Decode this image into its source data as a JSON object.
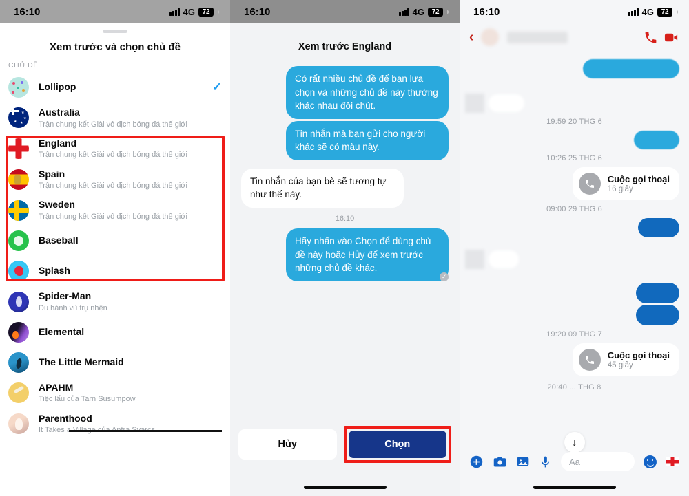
{
  "status_bar": {
    "time": "16:10",
    "network": "4G",
    "battery": "72"
  },
  "panel_theme_picker": {
    "sheet_title": "Xem trước và chọn chủ đề",
    "section_label": "CHỦ ĐỀ",
    "selected_theme": "Lollipop",
    "items": [
      {
        "name": "Lollipop",
        "subtitle": "",
        "icon": "lollipop-avatar",
        "selected": true
      },
      {
        "name": "Australia",
        "subtitle": "Trận chung kết Giải vô địch bóng đá thế giới",
        "icon": "flag-australia-icon",
        "selected": false
      },
      {
        "name": "England",
        "subtitle": "Trận chung kết Giải vô địch bóng đá thế giới",
        "icon": "flag-england-icon",
        "selected": false
      },
      {
        "name": "Spain",
        "subtitle": "Trận chung kết Giải vô địch bóng đá thế giới",
        "icon": "flag-spain-icon",
        "selected": false
      },
      {
        "name": "Sweden",
        "subtitle": "Trận chung kết Giải vô địch bóng đá thế giới",
        "icon": "flag-sweden-icon",
        "selected": false
      },
      {
        "name": "Baseball",
        "subtitle": "",
        "icon": "baseball-avatar",
        "selected": false
      },
      {
        "name": "Splash",
        "subtitle": "",
        "icon": "splash-avatar",
        "selected": false
      },
      {
        "name": "Spider-Man",
        "subtitle": "Du hành vũ trụ nhện",
        "icon": "spiderman-avatar",
        "selected": false
      },
      {
        "name": "Elemental",
        "subtitle": "",
        "icon": "elemental-avatar",
        "selected": false
      },
      {
        "name": "The Little Mermaid",
        "subtitle": "",
        "icon": "mermaid-avatar",
        "selected": false
      },
      {
        "name": "APAHM",
        "subtitle": "Tiệc lẩu của Tarn Susumpow",
        "icon": "apahm-avatar",
        "selected": false
      },
      {
        "name": "Parenthood",
        "subtitle": "It Takes a Village của Antra Svarcs",
        "icon": "parenthood-avatar",
        "selected": false
      }
    ]
  },
  "panel_preview": {
    "title": "Xem trước England",
    "messages": [
      {
        "side": "out",
        "text": "Có rất nhiều chủ đề để bạn lựa chọn và những chủ đề này thường khác nhau đôi chút."
      },
      {
        "side": "out",
        "text": "Tin nhắn mà bạn gửi cho người khác sẽ có màu này."
      },
      {
        "side": "in",
        "text": "Tin nhắn của bạn bè sẽ tương tự như thế này."
      }
    ],
    "timestamp": "16:10",
    "last_message": {
      "side": "out",
      "text": "Hãy nhấn vào Chọn để dùng chủ đề này hoặc Hủy để xem trước những chủ đề khác."
    },
    "cancel_label": "Hủy",
    "choose_label": "Chọn"
  },
  "panel_conversation": {
    "timestamps": [
      "19:59 20 THG 6",
      "10:26 25 THG 6",
      "09:00 29 THG 6",
      "19:20 09 THG 7",
      "20:40 ... THG 8"
    ],
    "calls": [
      {
        "title": "Cuộc gọi thoại",
        "duration": "16 giây"
      },
      {
        "title": "Cuộc gọi thoại",
        "duration": "45 giây"
      }
    ],
    "composer_placeholder": "Aa",
    "toolbar_icons": [
      "plus-icon",
      "camera-icon",
      "gallery-icon",
      "microphone-icon",
      "emoji-icon",
      "flag-england-sticker-icon"
    ],
    "header_icons": [
      "back-icon",
      "voice-call-icon",
      "video-call-icon"
    ],
    "scroll_down_icon": "arrow-down-icon"
  },
  "colors": {
    "accent_blue": "#2aa9dd",
    "deep_blue": "#16368a",
    "highlight_red": "#ef1d18",
    "theme_red": "#d7201a"
  }
}
